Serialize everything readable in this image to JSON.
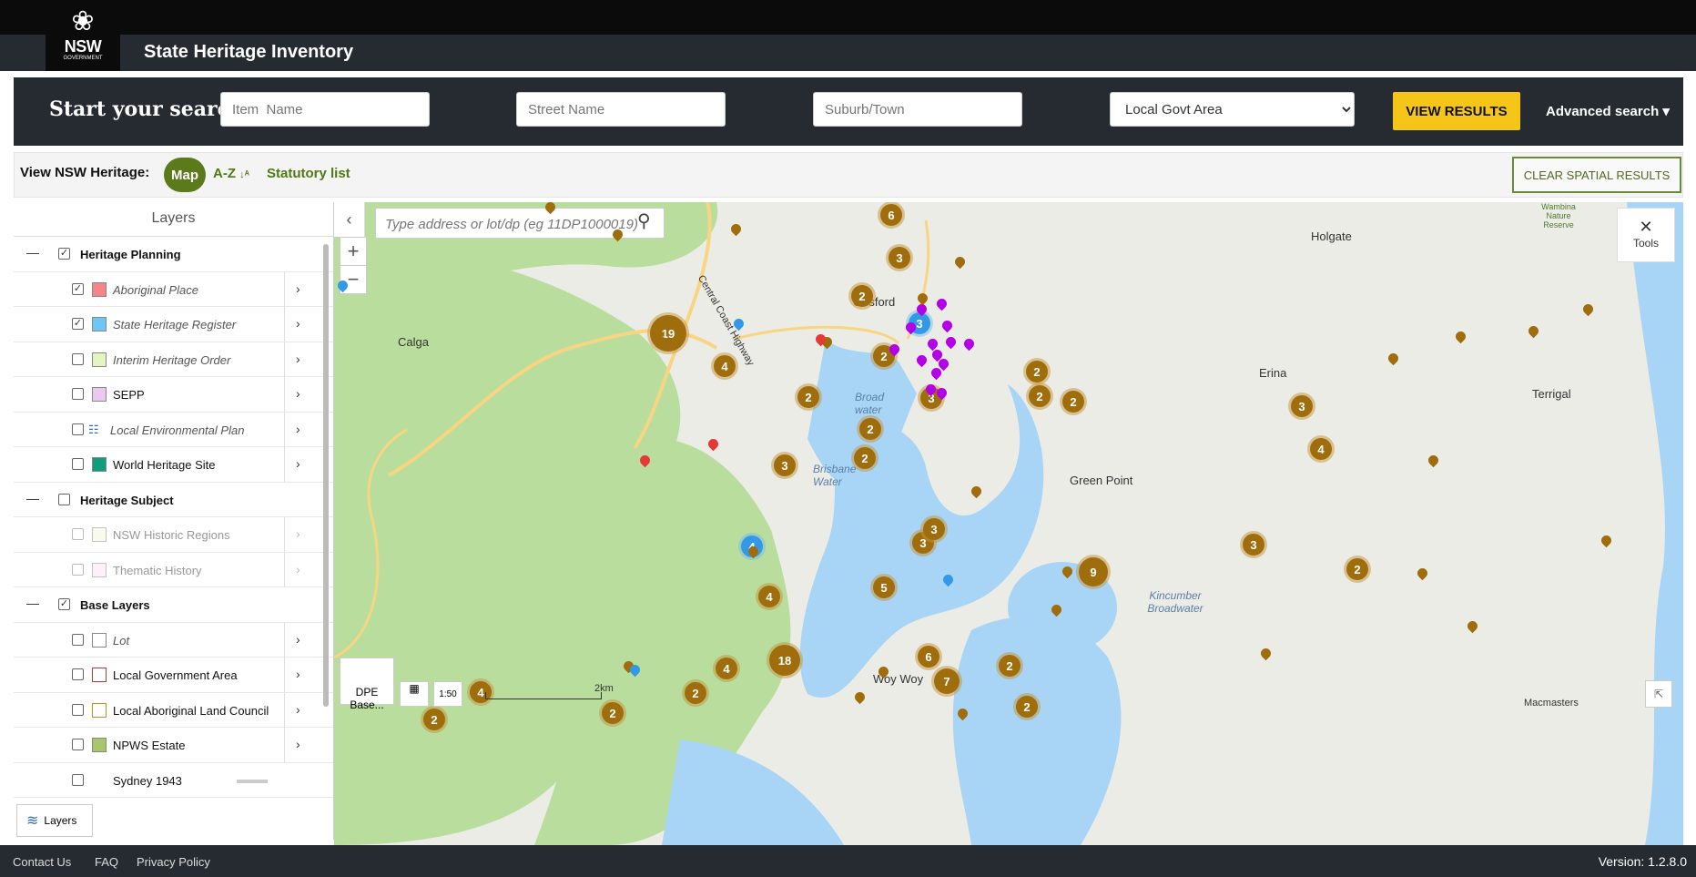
{
  "header": {
    "logo_text": "NSW",
    "logo_sub": "GOVERNMENT",
    "title": "State Heritage Inventory"
  },
  "search": {
    "label": "Start your search",
    "item_name_placeholder": "Item  Name",
    "street_placeholder": "Street Name",
    "suburb_placeholder": "Suburb/Town",
    "lga_selected": "Local Govt Area",
    "view_button": "VIEW RESULTS",
    "advanced": "Advanced search ▾"
  },
  "viewbar": {
    "label": "View NSW Heritage:",
    "map": "Map",
    "az": "A-Z",
    "statutory": "Statutory list",
    "clear": "CLEAR SPATIAL RESULTS"
  },
  "layers": {
    "title": "Layers",
    "groups": [
      {
        "label": "Heritage Planning",
        "checked": true,
        "items": [
          {
            "label": "Aboriginal Place",
            "checked": true,
            "color": "#f4858a",
            "italic": true
          },
          {
            "label": "State Heritage Register",
            "checked": true,
            "color": "#6ec6f5",
            "italic": true
          },
          {
            "label": "Interim Heritage Order",
            "checked": false,
            "color": "#e5f5c2",
            "italic": true
          },
          {
            "label": "SEPP",
            "checked": false,
            "color": "#eac8f0",
            "italic": false
          },
          {
            "label": "Local Environmental Plan",
            "checked": false,
            "color": "legend",
            "italic": true
          },
          {
            "label": "World Heritage Site",
            "checked": false,
            "color": "#0f9d7e",
            "italic": false
          }
        ]
      },
      {
        "label": "Heritage Subject",
        "checked": false,
        "items": [
          {
            "label": "NSW Historic Regions",
            "checked": false,
            "color": "#f2f7df",
            "grey": true
          },
          {
            "label": "Thematic History",
            "checked": false,
            "color": "#fbe3f5",
            "grey": true
          }
        ]
      },
      {
        "label": "Base Layers",
        "checked": true,
        "items": [
          {
            "label": "Lot",
            "checked": false,
            "color": "#ffffff",
            "italic": true
          },
          {
            "label": "Local Government Area",
            "checked": false,
            "color": "#ffffff",
            "border": "#c0392b"
          },
          {
            "label": "Local Aboriginal Land Council",
            "checked": false,
            "color": "#ffffff",
            "border": "#c58a2a"
          },
          {
            "label": "NPWS Estate",
            "checked": false,
            "color": "#a8c66c"
          },
          {
            "label": "Sydney 1943",
            "checked": false,
            "slider": true
          }
        ]
      }
    ],
    "button": "Layers"
  },
  "map": {
    "search_placeholder": "Type address or lot/dp (eg 11DP1000019)",
    "tools": "Tools",
    "basemap": "DPE Base...",
    "scale": "2km",
    "places": [
      {
        "name": "Gosford",
        "style": "town"
      },
      {
        "name": "Calga",
        "style": "town"
      },
      {
        "name": "Erina",
        "style": "town"
      },
      {
        "name": "Holgate",
        "style": "town"
      },
      {
        "name": "Green Point",
        "style": "town"
      },
      {
        "name": "Terrigal",
        "style": "town"
      },
      {
        "name": "Woy Woy",
        "style": "town"
      },
      {
        "name": "Macmasters",
        "style": "town"
      },
      {
        "name": "Broad water",
        "style": "water"
      },
      {
        "name": "Brisbane Water",
        "style": "water"
      },
      {
        "name": "Kincumber Broadwater",
        "style": "water"
      },
      {
        "name": "Wambina Nature Reserve",
        "style": "park"
      },
      {
        "name": "Central Coast Highway",
        "style": "road"
      }
    ],
    "clusters": [
      "6",
      "3",
      "3",
      "2",
      "19",
      "4",
      "2",
      "2",
      "3",
      "2",
      "2",
      "3",
      "2",
      "2",
      "3",
      "2",
      "4",
      "3",
      "4",
      "2",
      "3",
      "5",
      "9",
      "4",
      "18",
      "6",
      "4",
      "2",
      "7",
      "2",
      "2",
      "3",
      "4",
      "2",
      "2"
    ],
    "colors": {
      "cluster": "#a06d0c",
      "blue": "#3399e6",
      "purple": "#b300e6",
      "red": "#e53935",
      "water": "#a8d5f5",
      "park": "#b9dd9d",
      "land": "#ecece7",
      "road": "#f7d583"
    }
  },
  "footer": {
    "contact": "Contact Us",
    "faq": "FAQ",
    "privacy": "Privacy Policy",
    "version": "Version: 1.2.8.0"
  }
}
